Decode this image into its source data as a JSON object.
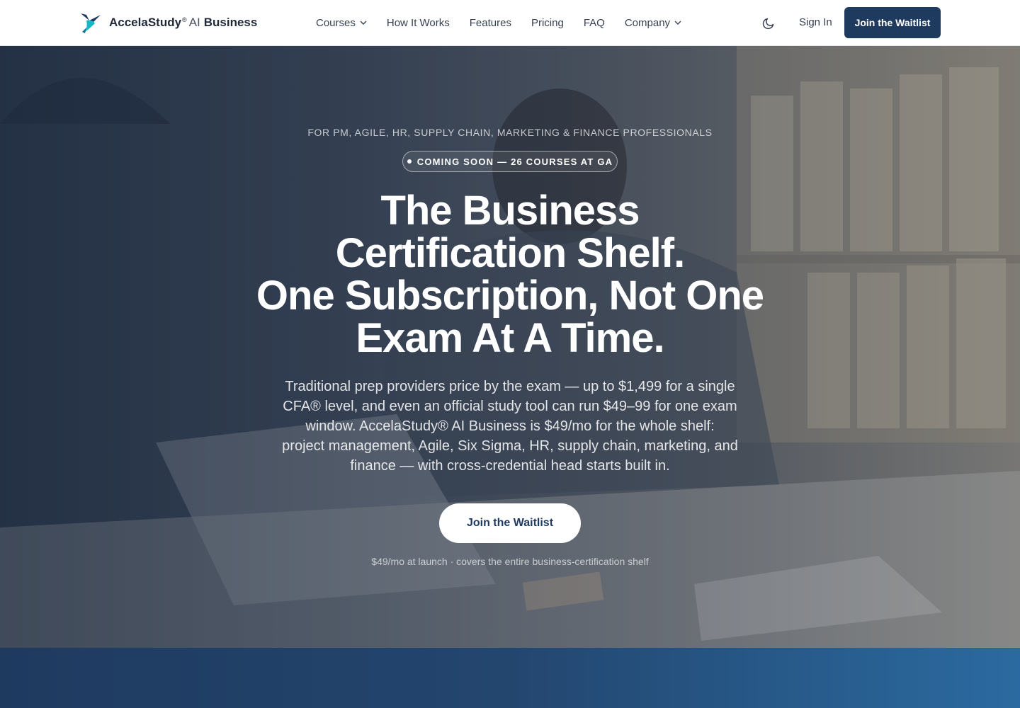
{
  "brand": {
    "name": "AccelaStudy",
    "registered": "®",
    "ai": "AI",
    "suffix": "Business"
  },
  "nav": {
    "links": [
      {
        "label": "Courses",
        "has_dropdown": true
      },
      {
        "label": "How It Works",
        "has_dropdown": false
      },
      {
        "label": "Features",
        "has_dropdown": false
      },
      {
        "label": "Pricing",
        "has_dropdown": false
      },
      {
        "label": "FAQ",
        "has_dropdown": false
      },
      {
        "label": "Company",
        "has_dropdown": true
      }
    ],
    "theme_icon": "moon-icon",
    "sign_in": "Sign In",
    "cta": "Join the Waitlist"
  },
  "hero": {
    "eyebrow": "FOR PM, AGILE, HR, SUPPLY CHAIN, MARKETING & FINANCE PROFESSIONALS",
    "badge": "COMING SOON — 26 COURSES AT GA",
    "headline": [
      "The Business",
      "Certification Shelf.",
      "One Subscription, Not One",
      "Exam At A Time."
    ],
    "subcopy_lines": [
      "Traditional prep providers price by the exam — up to $1,499 for a single",
      "CFA® level, and even an official study tool can run $49–99 for one exam",
      "window. AccelaStudy® AI Business is $49/mo for the whole shelf:",
      "project management, Agile, Six Sigma, HR, supply chain, marketing, and",
      "finance — with cross-credential head starts built in."
    ],
    "cta": "Join the Waitlist",
    "fineprint": "$49/mo at launch · covers the entire business-certification shelf"
  },
  "colors": {
    "primary": "#1e3a5f",
    "white": "#ffffff",
    "band_end": "#2b6aa0",
    "logo_teal": "#14b8c6"
  }
}
